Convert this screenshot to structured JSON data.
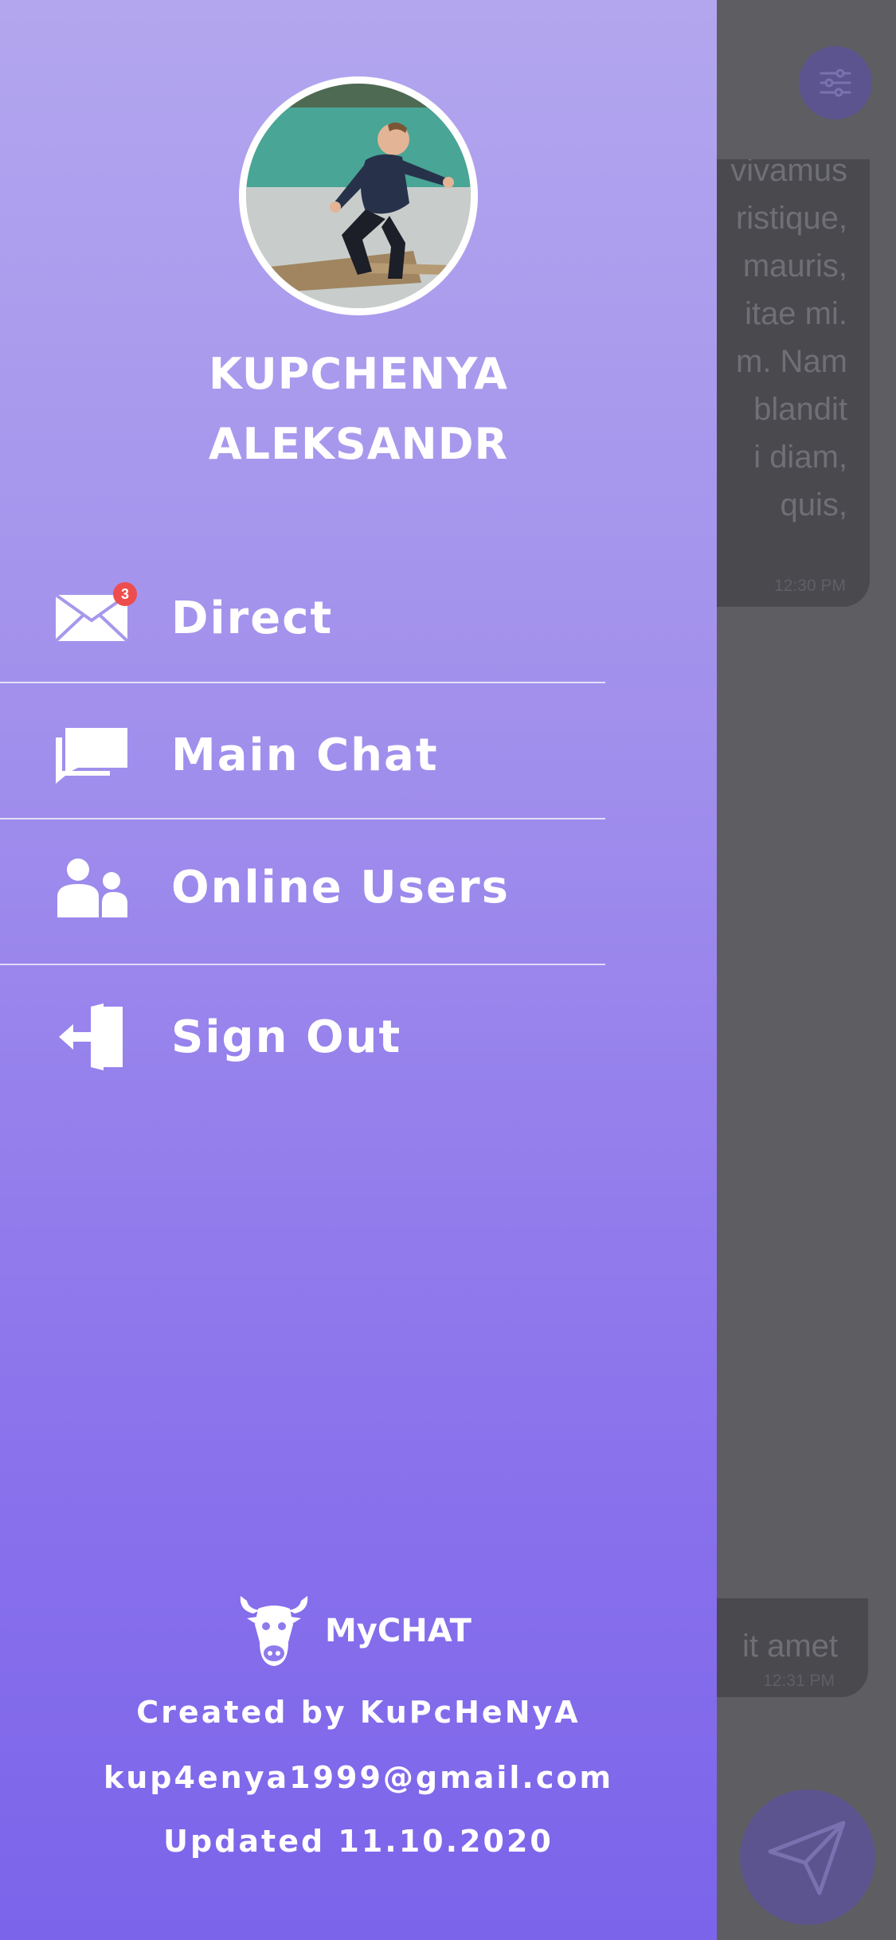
{
  "user": {
    "name_line1": "KUPCHENYA",
    "name_line2": "ALEKSANDR",
    "avatar_icon": "profile-photo"
  },
  "menu": [
    {
      "label": "Direct",
      "icon": "envelope-icon",
      "badge": "3"
    },
    {
      "label": "Main Chat",
      "icon": "chat-bubbles-icon"
    },
    {
      "label": "Online Users",
      "icon": "users-icon"
    },
    {
      "label": "Sign Out",
      "icon": "sign-out-icon"
    }
  ],
  "brand": {
    "name": "MyCHAT",
    "logo_icon": "bull-head-icon"
  },
  "footer": {
    "created_by": "Created by KuPcHeNyA",
    "email": "kup4enya1999@gmail.com",
    "updated": "Updated 11.10.2020"
  },
  "background_chat": {
    "message1_lines": [
      "vivamus",
      "ristique,",
      "mauris,",
      "itae mi.",
      "m. Nam",
      "blandit",
      "i diam,",
      "quis,"
    ],
    "message1_time": "12:30 PM",
    "message2_text": "it amet",
    "message2_time": "12:31 PM"
  },
  "colors": {
    "drawer_top": "#b3a6ee",
    "drawer_bottom": "#7b64ea",
    "badge": "#ee4d4d",
    "overlay": "#5e5e62"
  }
}
